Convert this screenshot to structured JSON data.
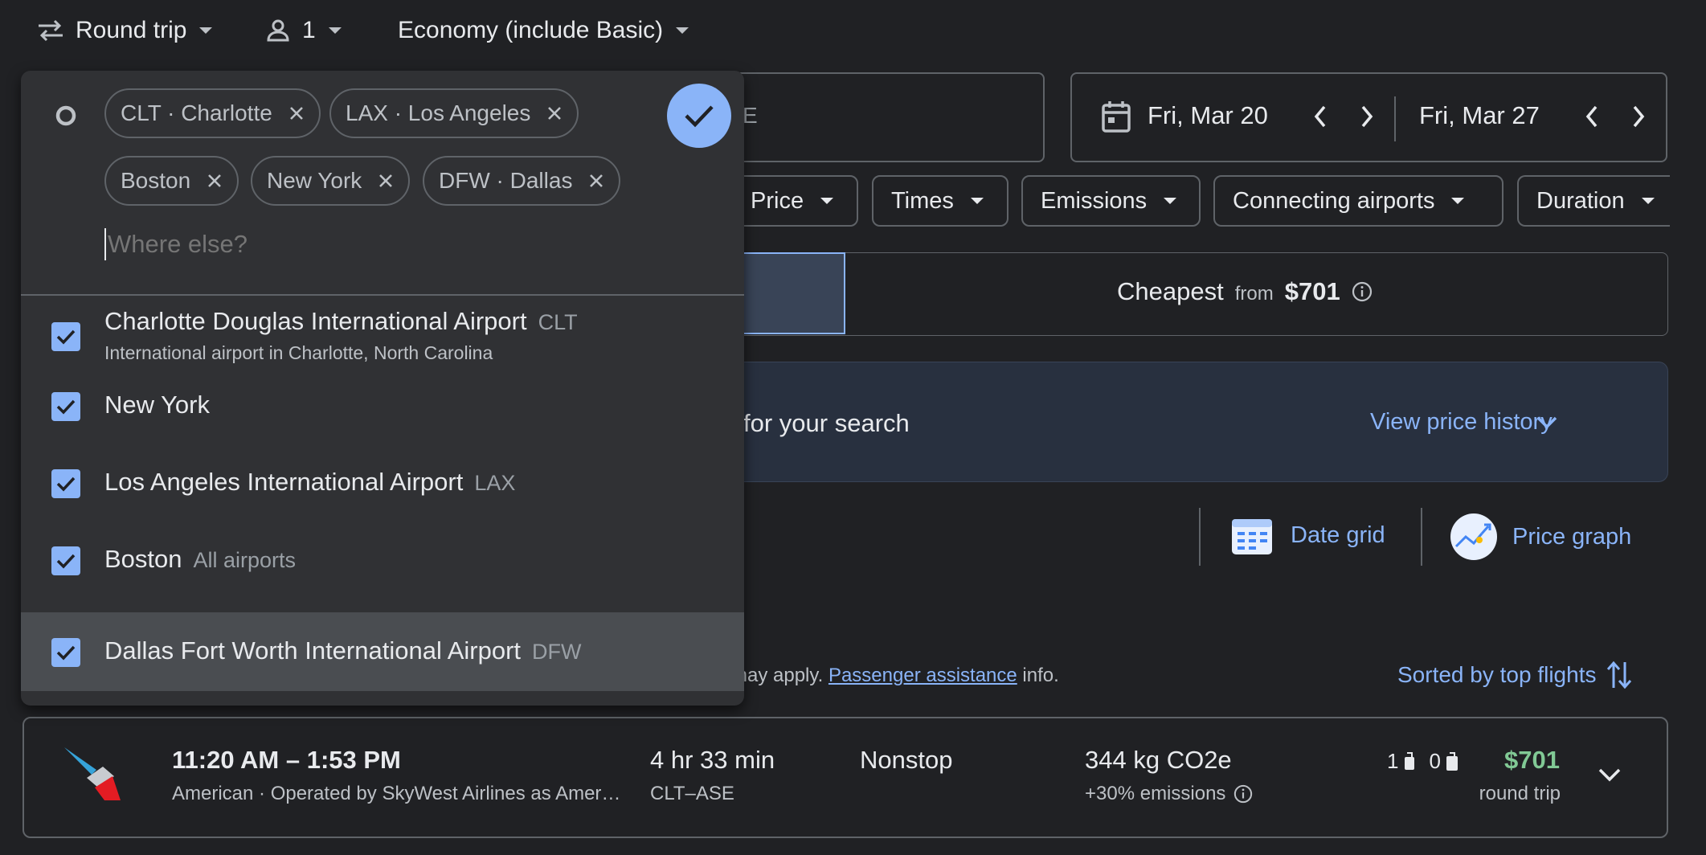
{
  "trip": {
    "type_label": "Round trip",
    "passengers": "1",
    "cabin": "Economy (include Basic)"
  },
  "search": {
    "destination_partial": "E"
  },
  "dates": {
    "depart": "Fri, Mar 20",
    "return": "Fri, Mar 27"
  },
  "filters": [
    "Price",
    "Times",
    "Emissions",
    "Connecting airports",
    "Duration"
  ],
  "sort_tabs": {
    "cheapest_label": "Cheapest",
    "from_label": "from",
    "cheapest_price": "$701"
  },
  "banner": {
    "text": "for your search",
    "history_link": "View price history"
  },
  "tools": {
    "date_grid": "Date grid",
    "price_graph": "Price graph"
  },
  "notice": {
    "text_before": "may apply.",
    "link": "Passenger assistance",
    "text_after": "info.",
    "sorted": "Sorted by top flights"
  },
  "flight": {
    "times": "11:20 AM – 1:53 PM",
    "airline": "American · Operated by SkyWest Airlines as Amer…",
    "duration": "4 hr 33 min",
    "route": "CLT–ASE",
    "stops": "Nonstop",
    "emissions": "344 kg CO2e",
    "emissions_delta": "+30% emissions",
    "carry_on": "1",
    "checked": "0",
    "price": "$701",
    "price_type": "round trip"
  },
  "picker": {
    "tokens": [
      "CLT · Charlotte",
      "LAX · Los Angeles",
      "Boston",
      "New York",
      "DFW · Dallas"
    ],
    "placeholder": "Where else?",
    "options": [
      {
        "name": "Charlotte Douglas International Airport",
        "code": "CLT",
        "sub": "International airport in Charlotte, North Carolina",
        "checked": true
      },
      {
        "name": "New York",
        "code": "",
        "sub": "",
        "checked": true
      },
      {
        "name": "Los Angeles International Airport",
        "code": "LAX",
        "sub": "",
        "checked": true
      },
      {
        "name": "Boston",
        "code": "All airports",
        "sub": "",
        "checked": true
      },
      {
        "name": "Dallas Fort Worth International Airport",
        "code": "DFW",
        "sub": "",
        "checked": true
      }
    ]
  },
  "colors": {
    "accent": "#8ab4f8",
    "background": "#202124",
    "panel": "#303134",
    "price_green": "#81c995"
  }
}
